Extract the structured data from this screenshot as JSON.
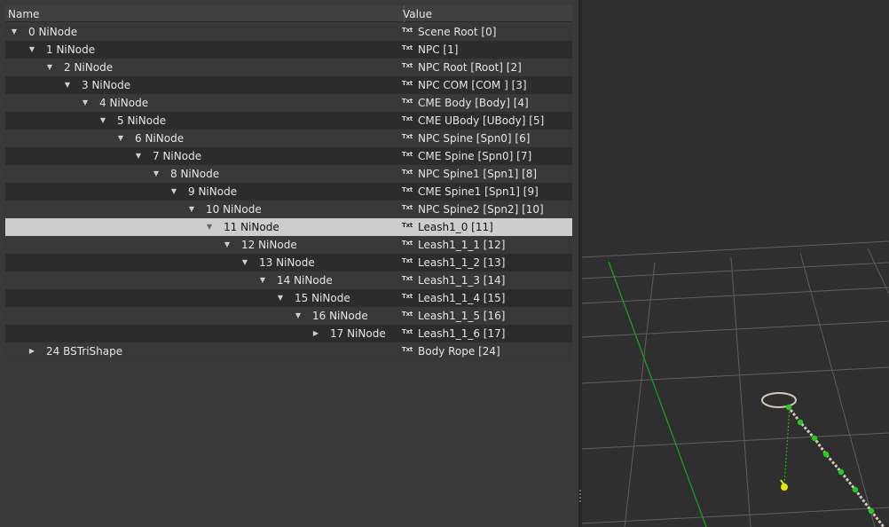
{
  "columns": {
    "name": "Name",
    "value": "Value"
  },
  "value_icon_label": "Txt",
  "rows": [
    {
      "name": "0 NiNode",
      "value": "Scene Root [0]",
      "depth": 0,
      "arrow": "expanded"
    },
    {
      "name": "1 NiNode",
      "value": "NPC [1]",
      "depth": 1,
      "arrow": "expanded"
    },
    {
      "name": "2 NiNode",
      "value": "NPC Root [Root] [2]",
      "depth": 2,
      "arrow": "expanded"
    },
    {
      "name": "3 NiNode",
      "value": "NPC COM [COM ] [3]",
      "depth": 3,
      "arrow": "expanded"
    },
    {
      "name": "4 NiNode",
      "value": "CME Body [Body] [4]",
      "depth": 4,
      "arrow": "expanded"
    },
    {
      "name": "5 NiNode",
      "value": "CME UBody [UBody] [5]",
      "depth": 5,
      "arrow": "expanded"
    },
    {
      "name": "6 NiNode",
      "value": "NPC Spine [Spn0] [6]",
      "depth": 6,
      "arrow": "expanded"
    },
    {
      "name": "7 NiNode",
      "value": "CME Spine [Spn0] [7]",
      "depth": 7,
      "arrow": "expanded"
    },
    {
      "name": "8 NiNode",
      "value": "NPC Spine1 [Spn1] [8]",
      "depth": 8,
      "arrow": "expanded"
    },
    {
      "name": "9 NiNode",
      "value": "CME Spine1 [Spn1] [9]",
      "depth": 9,
      "arrow": "expanded"
    },
    {
      "name": "10 NiNode",
      "value": "NPC Spine2 [Spn2] [10]",
      "depth": 10,
      "arrow": "expanded"
    },
    {
      "name": "11 NiNode",
      "value": "Leash1_0 [11]",
      "depth": 11,
      "arrow": "expanded",
      "selected": true
    },
    {
      "name": "12 NiNode",
      "value": "Leash1_1_1 [12]",
      "depth": 12,
      "arrow": "expanded"
    },
    {
      "name": "13 NiNode",
      "value": "Leash1_1_2 [13]",
      "depth": 13,
      "arrow": "expanded"
    },
    {
      "name": "14 NiNode",
      "value": "Leash1_1_3 [14]",
      "depth": 14,
      "arrow": "expanded"
    },
    {
      "name": "15 NiNode",
      "value": "Leash1_1_4 [15]",
      "depth": 15,
      "arrow": "expanded"
    },
    {
      "name": "16 NiNode",
      "value": "Leash1_1_5 [16]",
      "depth": 16,
      "arrow": "expanded"
    },
    {
      "name": "17 NiNode",
      "value": "Leash1_1_6 [17]",
      "depth": 17,
      "arrow": "collapsed"
    },
    {
      "name": "24 BSTriShape",
      "value": "Body Rope [24]",
      "depth": 1,
      "arrow": "collapsed"
    }
  ],
  "viewport": {
    "background": "#2f2f2f",
    "grid_color": "#5e5e5e",
    "axis_color": "#1f9e1f",
    "rope_color": "#d8c8b8",
    "node_color": "#22cc22",
    "marker_color": "#e8e800"
  }
}
